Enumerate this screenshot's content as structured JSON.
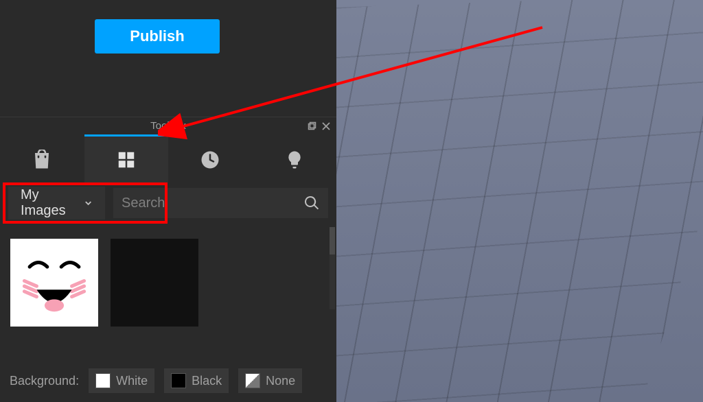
{
  "publish": {
    "label": "Publish"
  },
  "toolbox": {
    "title": "Toolbox",
    "tabs": [
      "marketplace",
      "inventory",
      "recent",
      "creations"
    ],
    "dropdown": {
      "selected": "My Images"
    },
    "search": {
      "placeholder": "Search"
    },
    "background": {
      "label": "Background:",
      "options": [
        "White",
        "Black",
        "None"
      ]
    }
  }
}
